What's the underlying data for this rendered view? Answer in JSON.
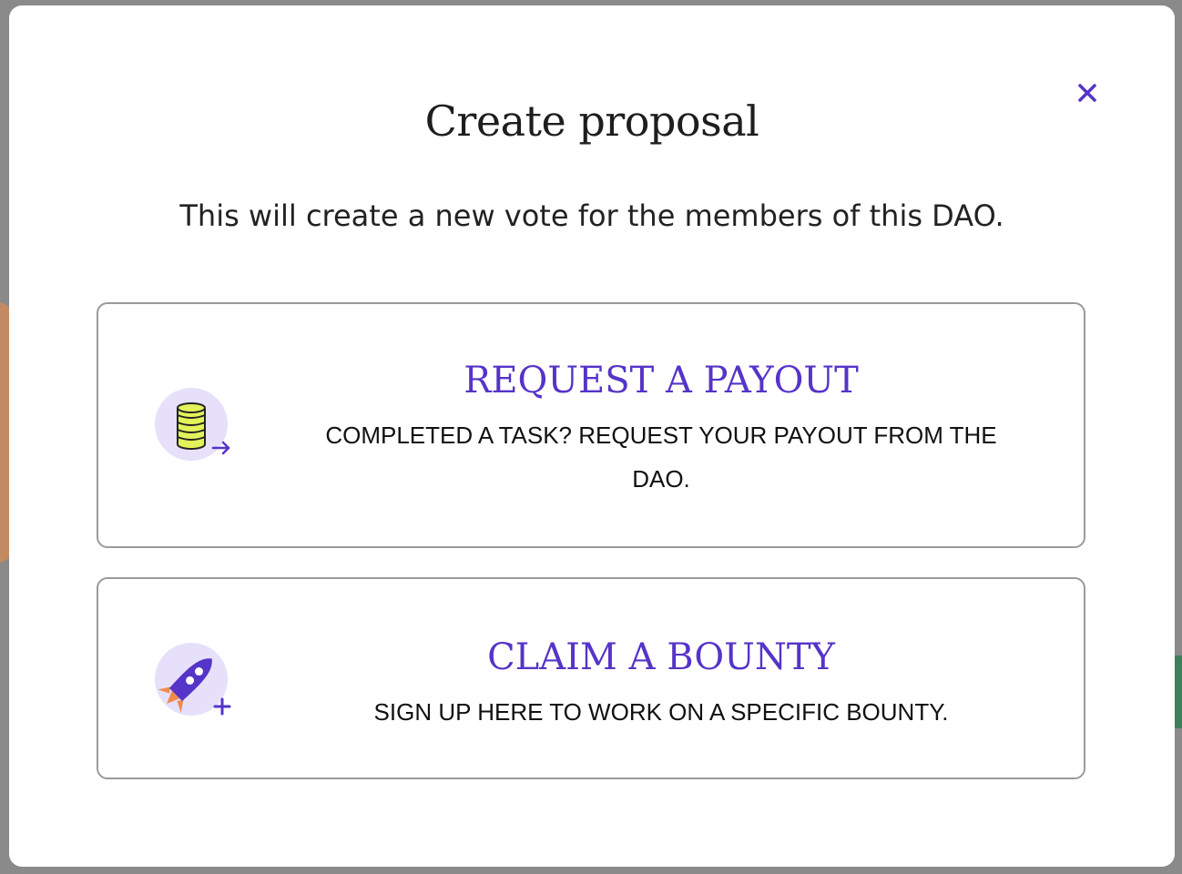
{
  "modal": {
    "title": "Create proposal",
    "subtitle": "This will create a new vote for the members of this DAO.",
    "close_icon": "close-icon"
  },
  "options": [
    {
      "title": "REQUEST A PAYOUT",
      "description": "COMPLETED A TASK? REQUEST YOUR PAYOUT FROM THE DAO.",
      "icon": "coins-arrow-icon"
    },
    {
      "title": "CLAIM A BOUNTY",
      "description": "SIGN UP HERE TO WORK ON A SPECIFIC BOUNTY.",
      "icon": "rocket-plus-icon"
    }
  ],
  "colors": {
    "accent": "#5534c8",
    "icon_bg": "#e6e0fb",
    "coin": "#e4f25a",
    "rocket_flame": "#f08a4b"
  }
}
